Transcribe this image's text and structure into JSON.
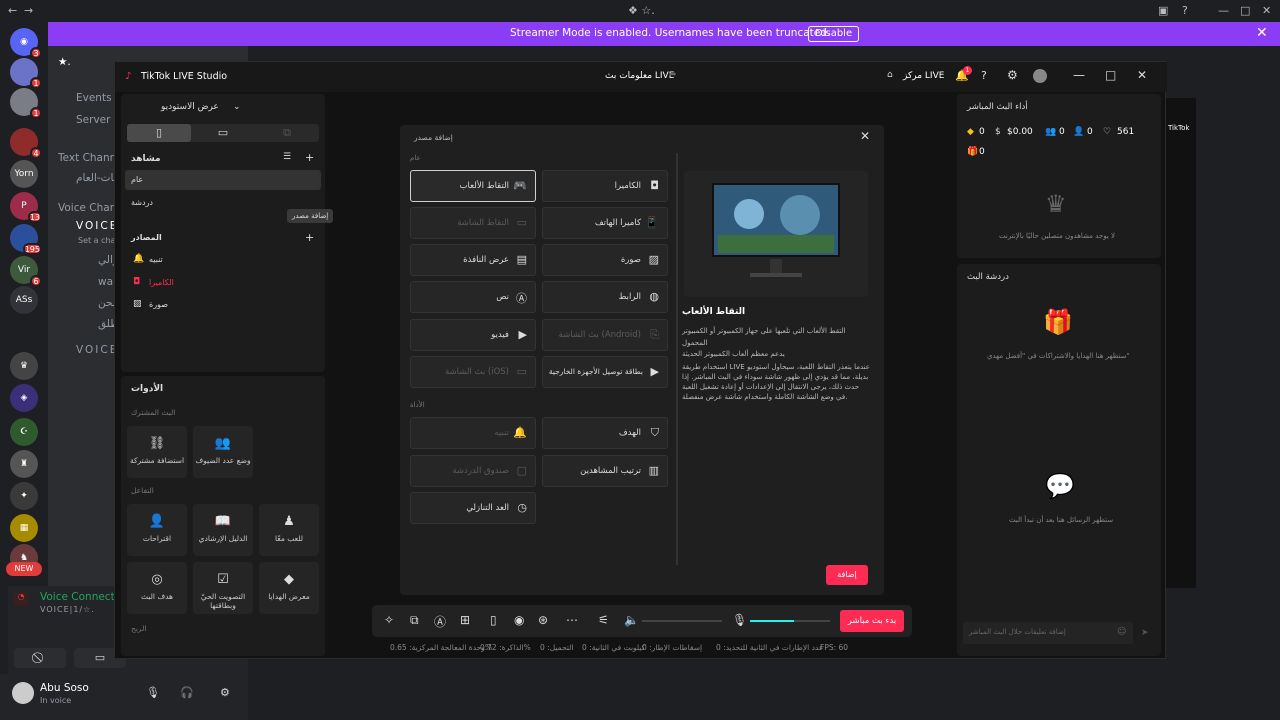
{
  "topbar": {},
  "streamer_banner": {
    "message": "Streamer Mode is enabled. Usernames have been truncated.",
    "disable_label": "Disable"
  },
  "rail": {
    "servers": [
      {
        "name": "discord-home",
        "badge": "3"
      },
      {
        "name": "server-2",
        "badge": "1"
      },
      {
        "name": "server-3",
        "badge": "1"
      },
      {
        "name": "server-4",
        "badge": "4"
      },
      {
        "name": "server-5",
        "label": "Yorn",
        "badge": ""
      },
      {
        "name": "server-6",
        "badge": "13"
      },
      {
        "name": "server-7",
        "badge": "195"
      },
      {
        "name": "server-8",
        "label": "Vir",
        "badge": "6"
      },
      {
        "name": "server-9",
        "label": "ASs",
        "badge": ""
      }
    ],
    "new_badge": "NEW"
  },
  "channels": {
    "server_name": "★.",
    "events": "Events",
    "server_e": "Server E",
    "text_channels": "Text Channels",
    "text_item": "شات-العام",
    "voice_channels": "Voice Channe",
    "voice_channel": "VOICE",
    "voice_sub": "Set a chan",
    "members": [
      "عزالي",
      "wal",
      "ملحن",
      "مطلق"
    ],
    "voice_channel_2": "VOICE"
  },
  "voice_connected": {
    "title": "Voice Connecte",
    "sub": "VOICE|1/☆."
  },
  "user": {
    "name": "Abu Soso",
    "status": "In voice"
  },
  "tiktok": {
    "title": "TikTok LIVE Studio",
    "stream_info": "معلومات بث LIVE",
    "live_center": "مركز LIVE",
    "bell_badge": "1",
    "studio_view": "عرض الاستوديو",
    "scenes_label": "مشاهد",
    "scene_1": "عام",
    "scene_2": "دردشة",
    "add_source_tooltip": "إضافة مصدر",
    "sources_label": "المصادر",
    "sources": [
      "تنبيه",
      "الكاميرا",
      "صورة"
    ],
    "tools_label": "الأدوات",
    "tools_section_1": "البث المشترك",
    "tools_section_2": "التفاعل",
    "tools_section_3": "الربح",
    "tools": [
      {
        "label": "استضافة مشتركة",
        "icon": "link-icon"
      },
      {
        "label": "وضع عدد الضيوف",
        "icon": "guests-icon"
      },
      {
        "label": "اقتراحات",
        "icon": "suggest-icon"
      },
      {
        "label": "الدليل الإرشادي",
        "icon": "guide-icon"
      },
      {
        "label": "للعب معًا",
        "icon": "play-icon"
      },
      {
        "label": "هدف البث",
        "icon": "target-icon"
      },
      {
        "label": "التصويت الحيّ وبطاقتها",
        "icon": "vote-icon"
      },
      {
        "label": "معرض الهدايا",
        "icon": "gift-icon"
      }
    ]
  },
  "modal": {
    "title": "إضافة مصدر",
    "section_general": "عام",
    "section_tools": "الأداة",
    "options": [
      {
        "label": "الكاميرا",
        "icon": "camera-icon",
        "state": "normal"
      },
      {
        "label": "التقاط الألعاب",
        "icon": "gamepad-icon",
        "state": "selected"
      },
      {
        "label": "كاميرا الهاتف",
        "icon": "phone-camera-icon",
        "state": "normal"
      },
      {
        "label": "التقاط الشاشة",
        "icon": "monitor-icon",
        "state": "disabled"
      },
      {
        "label": "صورة",
        "icon": "image-icon",
        "state": "normal"
      },
      {
        "label": "عرض النافذة",
        "icon": "window-icon",
        "state": "normal"
      },
      {
        "label": "الرابط",
        "icon": "globe-icon",
        "state": "normal"
      },
      {
        "label": "نص",
        "icon": "text-icon",
        "state": "normal"
      },
      {
        "label": "بث الشاشة (Android)",
        "icon": "cast-icon",
        "state": "disabled"
      },
      {
        "label": "فيديو",
        "icon": "video-icon",
        "state": "normal"
      },
      {
        "label": "بطاقة توصيل الأجهزة الخارجية",
        "icon": "capture-card-icon",
        "state": "normal"
      },
      {
        "label": "بث الشاشة (iOS)",
        "icon": "cast-icon",
        "state": "disabled"
      }
    ],
    "tool_options": [
      {
        "label": "الهدف",
        "icon": "target-icon",
        "state": "normal"
      },
      {
        "label": "تنبيه",
        "icon": "bell-icon",
        "state": "disabled"
      },
      {
        "label": "ترتيب المشاهدين",
        "icon": "ranking-icon",
        "state": "normal"
      },
      {
        "label": "صندوق الدردشة",
        "icon": "chat-icon",
        "state": "disabled"
      },
      {
        "label": "العد التنازلي",
        "icon": "timer-icon",
        "state": "normal"
      }
    ],
    "preview_title": "التقاط الألعاب",
    "preview_desc": "التقط الألعاب التي تلعبها على جهاز الكمبيوتر أو الكمبيوتر المحمول",
    "preview_desc_2": "يدعم معظم ألعاب الكمبيوتر الحديثة",
    "preview_desc_3": "استخدام طريقة LIVE عندما يتعذر التقاط اللعبة، سيحاول استوديو بديلة، مما قد يؤدي إلى ظهور شاشة سوداء في البث المباشر. إذا حدث ذلك، يرجى الانتقال إلى الإعدادات أو إعادة تشغيل اللعبة في وضع الشاشة الكاملة واستخدام شاشة عرض منفصلة.",
    "add_button": "إضافة"
  },
  "right_panel": {
    "performance_title": "أداء البث المباشر",
    "metrics": [
      {
        "icon": "diamond-icon",
        "value": "0"
      },
      {
        "icon": "dollar-icon",
        "value": "$0.00"
      },
      {
        "icon": "viewers-icon",
        "value": "0"
      },
      {
        "icon": "followers-icon",
        "value": "0"
      },
      {
        "icon": "heart-icon",
        "value": "561"
      }
    ],
    "gifts_value": "0",
    "no_viewers": "لا يوجد مشاهدون متصلين حاليًا بالإنترنت",
    "chat_title": "دردشة البث",
    "gifts_note": "ستظهر هنا الهدايا والاشتراكات في \"أفضل مهدي\"",
    "chat_note": "ستظهر الرسائل هنا بعد أن تبدأ البث",
    "chat_placeholder": "إضافة تعليقات حلال البث المباشر"
  },
  "toolbar": {
    "go_live": "بدء بث مباشر",
    "mic_level": 0.55
  },
  "stats": {
    "fps": "FPS: 60",
    "frames_rendered": "عدد الإطارات في الثانية للتحديد: 0",
    "frames_dropped": "إسقاطات الإطار: 0",
    "kbps": "كيلوبت في الثانية: 0",
    "loss": "التحميل: 0",
    "memory": "الذاكرة: 0.72%",
    "cpu": "وحدة المعالجة المركزية: 0.65%"
  }
}
